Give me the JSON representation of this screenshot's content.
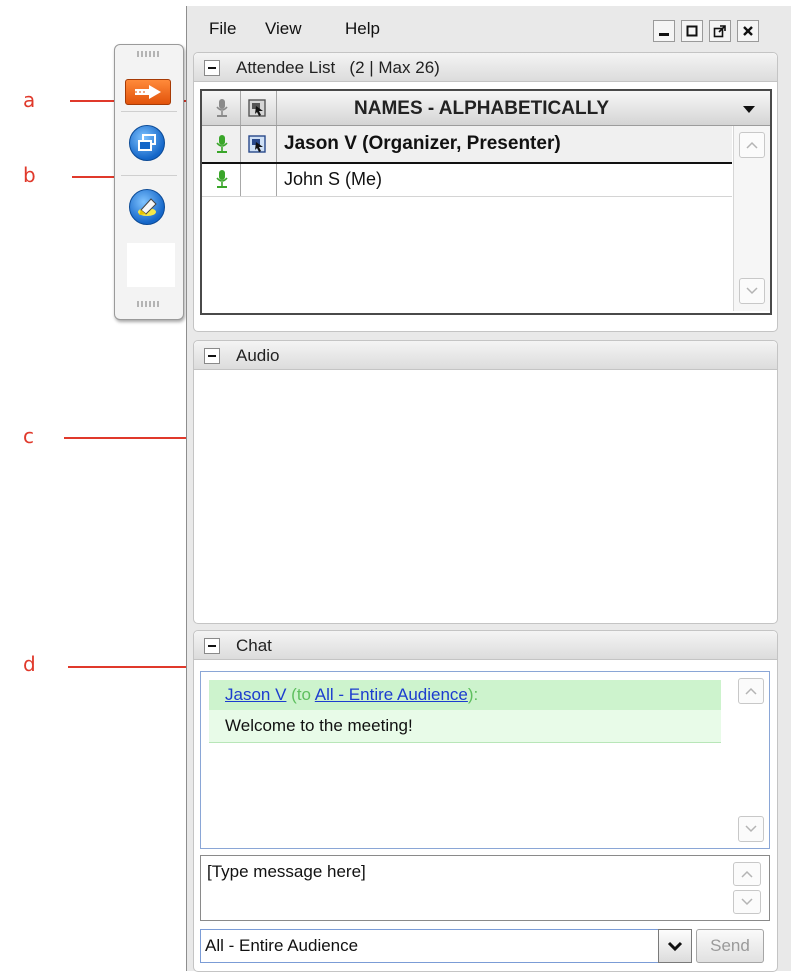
{
  "annotations": {
    "a": "a",
    "b": "b",
    "c": "c",
    "d": "d"
  },
  "menu": {
    "file": "File",
    "view": "View",
    "help": "Help"
  },
  "attendee_panel": {
    "title": "Attendee List",
    "count": "(2 | Max 26)",
    "column_header": "NAMES - ALPHABETICALLY",
    "rows": [
      {
        "name": "Jason V (Organizer, Presenter)",
        "bold": true
      },
      {
        "name": "John S (Me)",
        "bold": false
      }
    ]
  },
  "audio_panel": {
    "title": "Audio"
  },
  "chat_panel": {
    "title": "Chat",
    "message": {
      "sender": "Jason V",
      "to_prefix": "(to ",
      "recipient": "All - Entire Audience",
      "to_suffix": "):",
      "text": "Welcome to the meeting!"
    },
    "input_placeholder": "[Type message here]",
    "recipient_select": "All - Entire Audience",
    "send_label": "Send"
  },
  "colors": {
    "annotation": "#e0392b",
    "mic_green": "#3aa62a",
    "link_blue": "#1c3ccf",
    "chat_highlight": "#cdf3cd"
  },
  "icons": [
    "arrow-right-icon",
    "windows-icon",
    "highlighter-icon",
    "microphone-icon",
    "presenter-screen-icon"
  ]
}
